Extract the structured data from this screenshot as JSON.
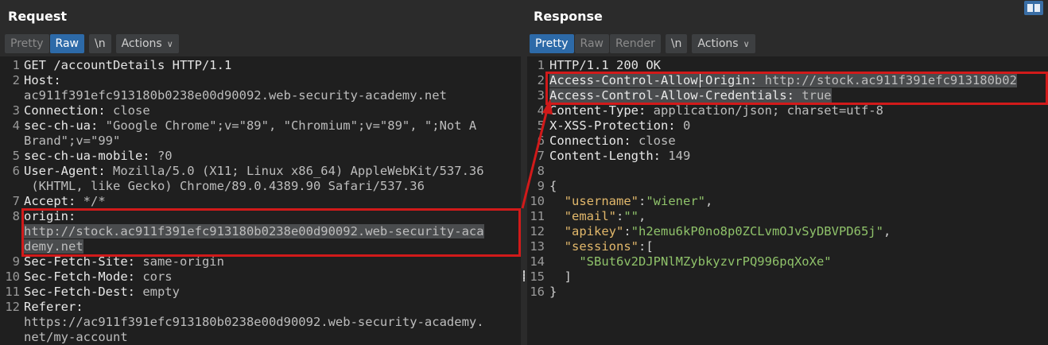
{
  "request": {
    "title": "Request",
    "toolbar": {
      "pretty": "Pretty",
      "raw": "Raw",
      "newline": "\\n",
      "actions": "Actions"
    },
    "lines": [
      {
        "num": "1",
        "parts": [
          {
            "t": "GET /accountDetails HTTP/1.1",
            "c": "k"
          }
        ]
      },
      {
        "num": "2",
        "parts": [
          {
            "t": "Host:",
            "c": "hname"
          }
        ]
      },
      {
        "num": "",
        "parts": [
          {
            "t": "ac911f391efc913180b0238e00d90092.web-security-academy.net",
            "c": "hval"
          }
        ]
      },
      {
        "num": "3",
        "parts": [
          {
            "t": "Connection:",
            "c": "hname"
          },
          {
            "t": " close",
            "c": "hval"
          }
        ]
      },
      {
        "num": "4",
        "parts": [
          {
            "t": "sec-ch-ua:",
            "c": "hname"
          },
          {
            "t": " \"Google Chrome\";v=\"89\", \"Chromium\";v=\"89\", \";Not A",
            "c": "hval"
          }
        ]
      },
      {
        "num": "",
        "parts": [
          {
            "t": "Brand\";v=\"99\"",
            "c": "hval"
          }
        ]
      },
      {
        "num": "5",
        "parts": [
          {
            "t": "sec-ch-ua-mobile:",
            "c": "hname"
          },
          {
            "t": " ?0",
            "c": "hval"
          }
        ]
      },
      {
        "num": "6",
        "parts": [
          {
            "t": "User-Agent:",
            "c": "hname"
          },
          {
            "t": " Mozilla/5.0 (X11; Linux x86_64) AppleWebKit/537.36",
            "c": "hval"
          }
        ]
      },
      {
        "num": "",
        "parts": [
          {
            "t": " (KHTML, like Gecko) Chrome/89.0.4389.90 Safari/537.36",
            "c": "hval"
          }
        ]
      },
      {
        "num": "7",
        "parts": [
          {
            "t": "Accept:",
            "c": "hname"
          },
          {
            "t": " */*",
            "c": "hval"
          }
        ]
      },
      {
        "num": "8",
        "parts": [
          {
            "t": "origin:",
            "c": "hname"
          }
        ]
      },
      {
        "num": "",
        "parts": [
          {
            "t": "http://stock.ac911f391efc913180b0238e00d90092.web-security-aca",
            "c": "hval hl"
          }
        ]
      },
      {
        "num": "",
        "parts": [
          {
            "t": "demy.net",
            "c": "hval hl"
          }
        ]
      },
      {
        "num": "9",
        "parts": [
          {
            "t": "Sec-Fetch-Site:",
            "c": "hname"
          },
          {
            "t": " same-origin",
            "c": "hval"
          }
        ]
      },
      {
        "num": "10",
        "parts": [
          {
            "t": "Sec-Fetch-Mode:",
            "c": "hname"
          },
          {
            "t": " cors",
            "c": "hval"
          }
        ]
      },
      {
        "num": "11",
        "parts": [
          {
            "t": "Sec-Fetch-Dest:",
            "c": "hname"
          },
          {
            "t": " empty",
            "c": "hval"
          }
        ]
      },
      {
        "num": "12",
        "parts": [
          {
            "t": "Referer:",
            "c": "hname"
          }
        ]
      },
      {
        "num": "",
        "parts": [
          {
            "t": "https://ac911f391efc913180b0238e00d90092.web-security-academy.",
            "c": "hval"
          }
        ]
      },
      {
        "num": "",
        "parts": [
          {
            "t": "net/my-account",
            "c": "hval"
          }
        ]
      }
    ]
  },
  "response": {
    "title": "Response",
    "toolbar": {
      "pretty": "Pretty",
      "raw": "Raw",
      "render": "Render",
      "newline": "\\n",
      "actions": "Actions"
    },
    "lines": [
      {
        "num": "1",
        "parts": [
          {
            "t": "HTTP/1.1 200 OK",
            "c": "k"
          }
        ]
      },
      {
        "num": "2",
        "parts": [
          {
            "t": "Access-Control-Allow-Origin:",
            "c": "hname hl"
          },
          {
            "t": " http://stock.ac911f391efc913180b02",
            "c": "hval hl"
          }
        ]
      },
      {
        "num": "3",
        "parts": [
          {
            "t": "Access-Control-Allow-Credentials:",
            "c": "hname hl"
          },
          {
            "t": " true",
            "c": "hval hl"
          }
        ]
      },
      {
        "num": "4",
        "parts": [
          {
            "t": "Content-Type:",
            "c": "hname"
          },
          {
            "t": " application/json; charset=utf-8",
            "c": "hval"
          }
        ]
      },
      {
        "num": "5",
        "parts": [
          {
            "t": "X-XSS-Protection:",
            "c": "hname"
          },
          {
            "t": " 0",
            "c": "hval"
          }
        ]
      },
      {
        "num": "6",
        "parts": [
          {
            "t": "Connection:",
            "c": "hname"
          },
          {
            "t": " close",
            "c": "hval"
          }
        ]
      },
      {
        "num": "7",
        "parts": [
          {
            "t": "Content-Length:",
            "c": "hname"
          },
          {
            "t": " 149",
            "c": "hval"
          }
        ]
      },
      {
        "num": "8",
        "parts": []
      },
      {
        "num": "9",
        "parts": [
          {
            "t": "{",
            "c": "jpunc"
          }
        ]
      },
      {
        "num": "10",
        "parts": [
          {
            "t": "  \"username\"",
            "c": "jkey"
          },
          {
            "t": ":",
            "c": "jpunc"
          },
          {
            "t": "\"wiener\"",
            "c": "jstr"
          },
          {
            "t": ",",
            "c": "jpunc"
          }
        ]
      },
      {
        "num": "11",
        "parts": [
          {
            "t": "  \"email\"",
            "c": "jkey"
          },
          {
            "t": ":",
            "c": "jpunc"
          },
          {
            "t": "\"\"",
            "c": "jstr"
          },
          {
            "t": ",",
            "c": "jpunc"
          }
        ]
      },
      {
        "num": "12",
        "parts": [
          {
            "t": "  \"apikey\"",
            "c": "jkey"
          },
          {
            "t": ":",
            "c": "jpunc"
          },
          {
            "t": "\"h2emu6kP0no8p0ZCLvmOJvSyDBVPD65j\"",
            "c": "jstr"
          },
          {
            "t": ",",
            "c": "jpunc"
          }
        ]
      },
      {
        "num": "13",
        "parts": [
          {
            "t": "  \"sessions\"",
            "c": "jkey"
          },
          {
            "t": ":[",
            "c": "jpunc"
          }
        ]
      },
      {
        "num": "14",
        "parts": [
          {
            "t": "    \"SBut6v2DJPNlMZybkyzvrPQ996pqXoXe\"",
            "c": "jstr"
          }
        ]
      },
      {
        "num": "15",
        "parts": [
          {
            "t": "  ]",
            "c": "jpunc"
          }
        ]
      },
      {
        "num": "16",
        "parts": [
          {
            "t": "}",
            "c": "jpunc"
          }
        ]
      }
    ]
  },
  "colors": {
    "accent": "#2d6aa8",
    "annotation": "#d11a1a",
    "background": "#2b2b2b",
    "editor_background": "#1f1f1f"
  },
  "icons": {
    "layout_toggle": "split-view-icon",
    "actions_chevron": "chevron-down-icon",
    "pane_divider": "drag-handle-icon"
  }
}
